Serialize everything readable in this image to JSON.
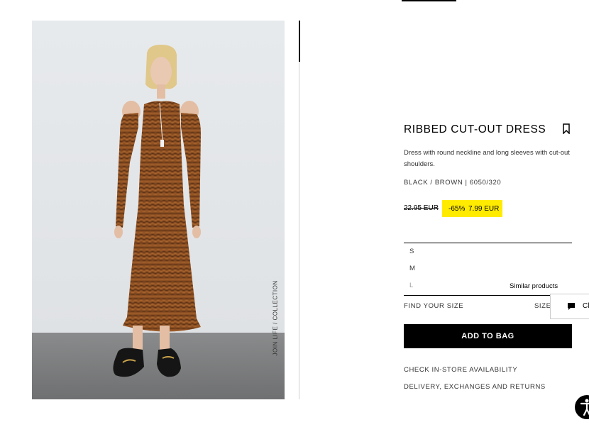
{
  "product": {
    "title": "RIBBED CUT-OUT DRESS",
    "description": "Dress with round neckline and long sleeves with cut-out shoulders.",
    "colour_ref": "BLACK / BROWN | 6050/320",
    "old_price": "22.95 EUR",
    "discount": "-65%",
    "new_price": "7.99 EUR",
    "image_caption": "JOIN LIFE / COLLECTION"
  },
  "sizes": [
    {
      "label": "S",
      "available": true
    },
    {
      "label": "M",
      "available": true
    },
    {
      "label": "L",
      "available": false
    }
  ],
  "similar_products_label": "Similar products",
  "find_your_size": "FIND YOUR SIZE",
  "size_guide": "SIZE",
  "chat_label": "Cl",
  "add_to_bag": "ADD TO BAG",
  "links": {
    "check_store": "CHECK IN-STORE AVAILABILITY",
    "delivery": "DELIVERY, EXCHANGES AND RETURNS"
  },
  "colors": {
    "sale_highlight": "#ffeb00",
    "button_bg": "#000000",
    "dress": "#8a4e22"
  },
  "icons": {
    "bookmark": "bookmark-icon",
    "chat": "chat-icon",
    "accessibility": "accessibility-icon"
  }
}
